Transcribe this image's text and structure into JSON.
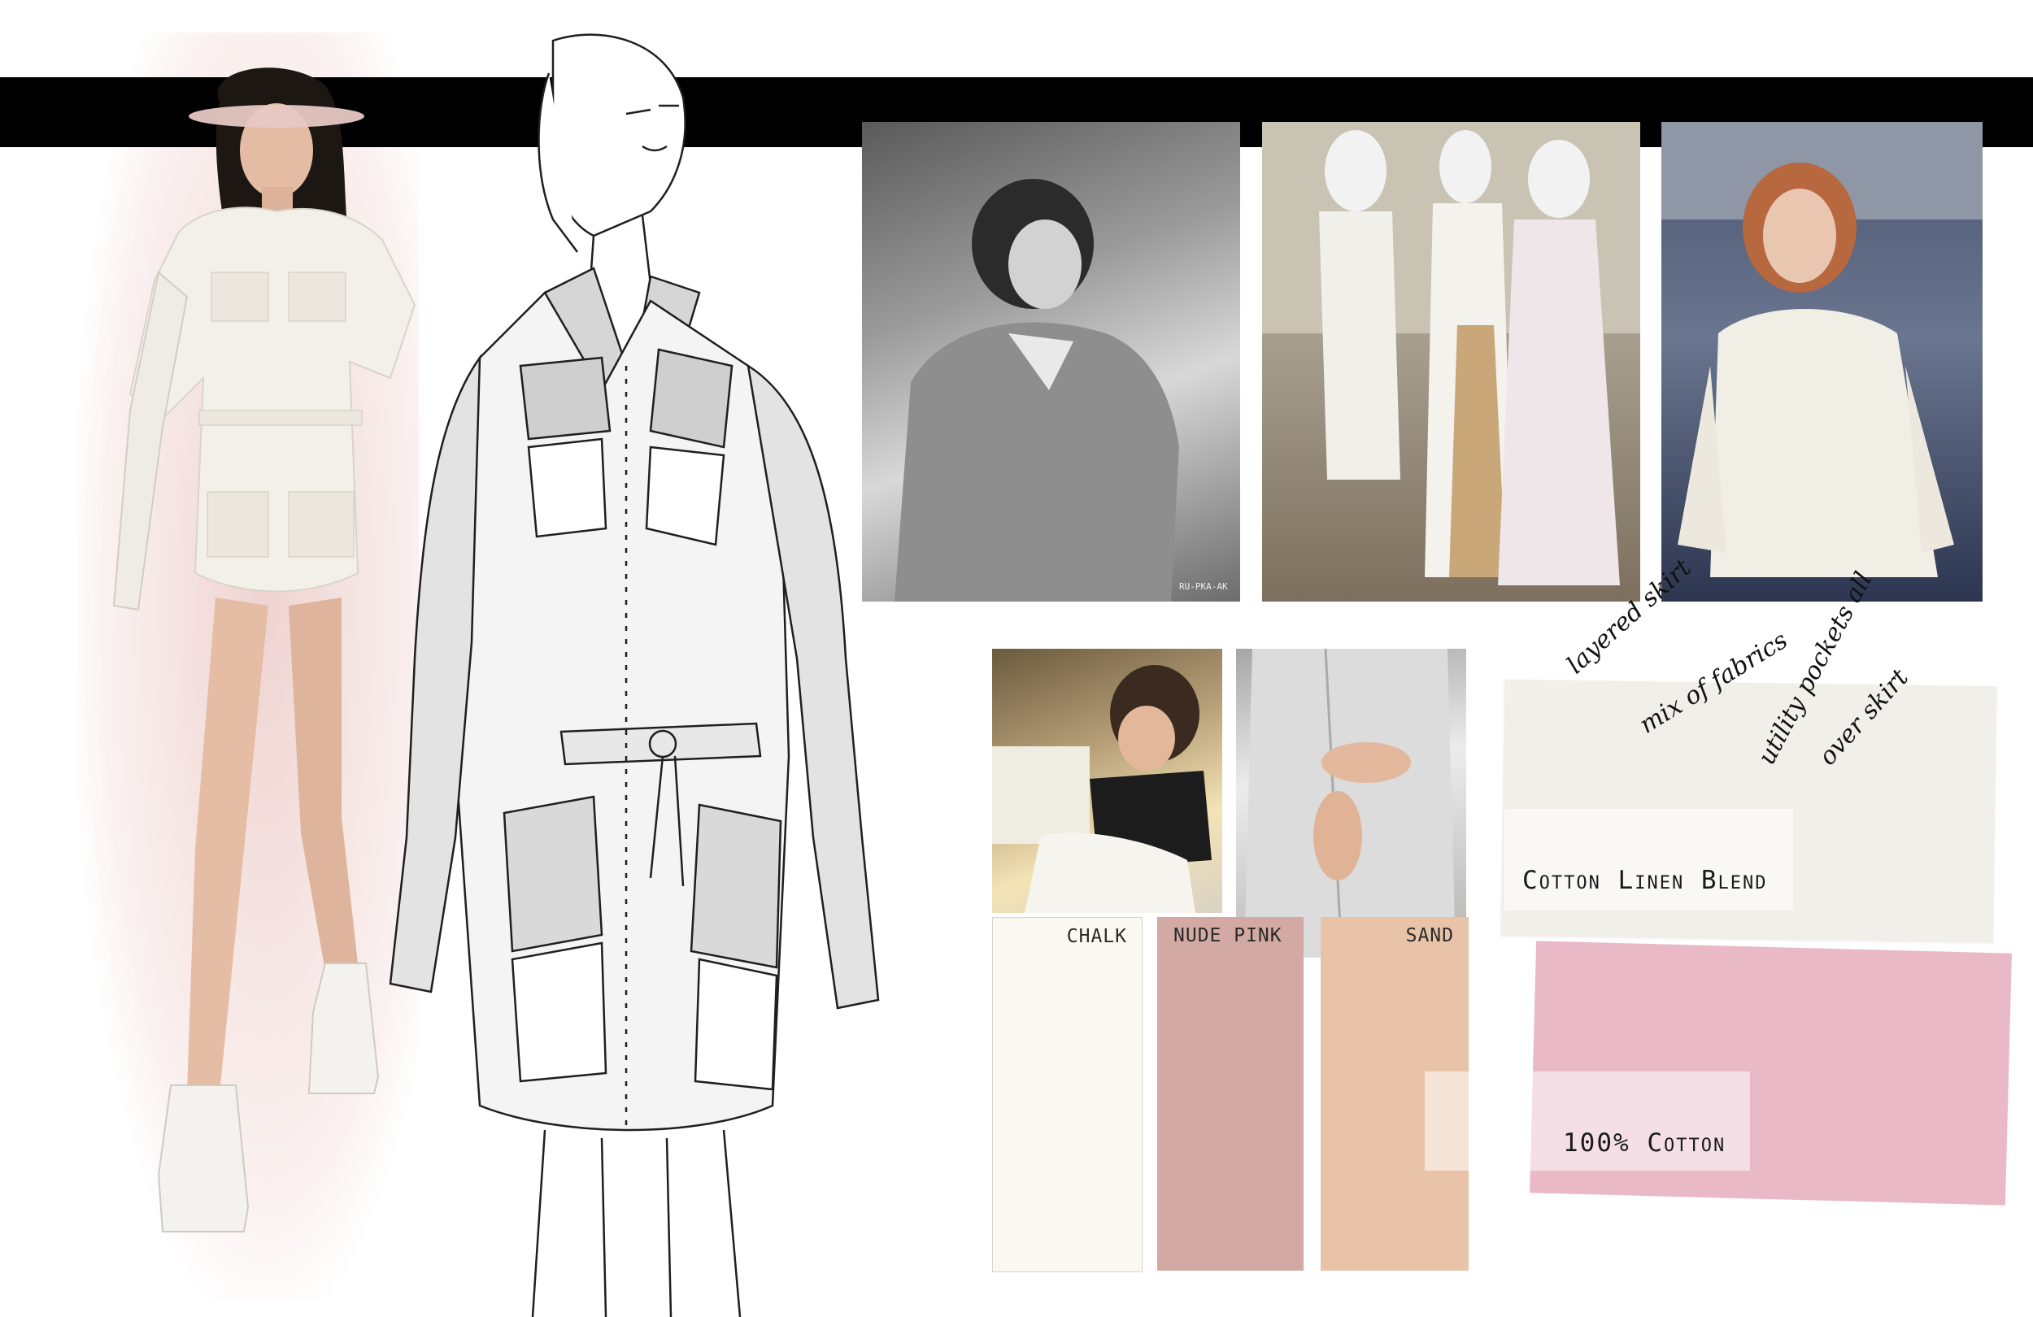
{
  "colors": {
    "band": "#000000",
    "chalk": "#fbf8f1",
    "nude_pink": "#d2aaa3",
    "sand": "#e9c3a8",
    "linen_fabric": "#f1efe9",
    "cotton_fabric": "#e9b9c7",
    "wash": "#e6b7b2"
  },
  "swatches": [
    {
      "label": "CHALK",
      "color": "#fbf8f1"
    },
    {
      "label": "NUDE PINK",
      "color": "#d2aaa3"
    },
    {
      "label": "SAND",
      "color": "#e9c3a8"
    }
  ],
  "fabrics": {
    "linen_label": "Cotton Linen Blend",
    "cotton_label": "100% Cotton"
  },
  "notes": {
    "note1": "layered skirt",
    "note2": "mix of fabrics",
    "note3": "utility pockets all",
    "note4": "over skirt"
  },
  "photo_caption": "RU-PKA-AK"
}
